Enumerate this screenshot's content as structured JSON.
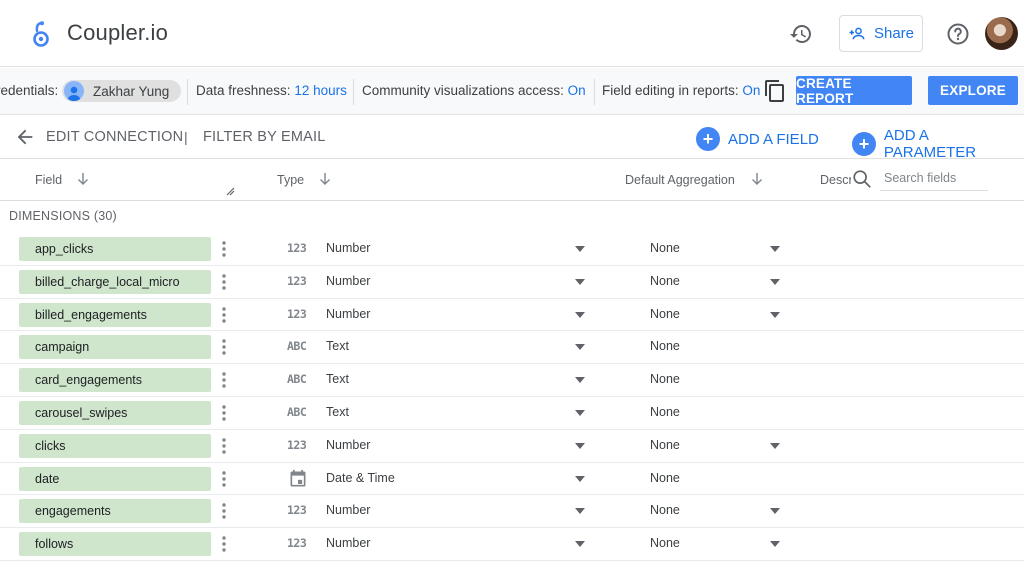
{
  "app": {
    "title": "Coupler.io"
  },
  "header": {
    "share_label": "Share",
    "icons": [
      "history-icon",
      "person-add-icon",
      "help-icon"
    ]
  },
  "infobar": {
    "credentials_label": "redentials:",
    "credentials_user": "Zakhar Yung",
    "freshness_label": "Data freshness:",
    "freshness_value": "12 hours",
    "community_label": "Community visualizations access:",
    "community_value": "On",
    "field_editing_label": "Field editing in reports:",
    "field_editing_value": "On",
    "create_report_label": "CREATE REPORT",
    "explore_label": "EXPLORE"
  },
  "toolbar": {
    "edit_connection_label": "EDIT CONNECTION",
    "separator": "|",
    "filter_label": "FILTER BY EMAIL",
    "add_field_label": "ADD A FIELD",
    "add_parameter_label": "ADD A PARAMETER"
  },
  "columns": {
    "field": "Field",
    "type": "Type",
    "default_aggregation": "Default Aggregation",
    "description": "Descr"
  },
  "search": {
    "placeholder": "Search fields"
  },
  "dimensions_label": "DIMENSIONS (30)",
  "rows": [
    {
      "name": "app_clicks",
      "type_glyph": "123",
      "type": "Number",
      "aggregation": "None",
      "agg_dropdown": true
    },
    {
      "name": "billed_charge_local_micro",
      "type_glyph": "123",
      "type": "Number",
      "aggregation": "None",
      "agg_dropdown": true
    },
    {
      "name": "billed_engagements",
      "type_glyph": "123",
      "type": "Number",
      "aggregation": "None",
      "agg_dropdown": true
    },
    {
      "name": "campaign",
      "type_glyph": "ABC",
      "type": "Text",
      "aggregation": "None",
      "agg_dropdown": false
    },
    {
      "name": "card_engagements",
      "type_glyph": "ABC",
      "type": "Text",
      "aggregation": "None",
      "agg_dropdown": false
    },
    {
      "name": "carousel_swipes",
      "type_glyph": "ABC",
      "type": "Text",
      "aggregation": "None",
      "agg_dropdown": false
    },
    {
      "name": "clicks",
      "type_glyph": "123",
      "type": "Number",
      "aggregation": "None",
      "agg_dropdown": true
    },
    {
      "name": "date",
      "type_glyph": "calendar",
      "type": "Date & Time",
      "aggregation": "None",
      "agg_dropdown": false
    },
    {
      "name": "engagements",
      "type_glyph": "123",
      "type": "Number",
      "aggregation": "None",
      "agg_dropdown": true
    },
    {
      "name": "follows",
      "type_glyph": "123",
      "type": "Number",
      "aggregation": "None",
      "agg_dropdown": true
    }
  ],
  "colors": {
    "accent": "#1a73e8",
    "button": "#4285f4",
    "field_chip": "#cfe6cd"
  }
}
